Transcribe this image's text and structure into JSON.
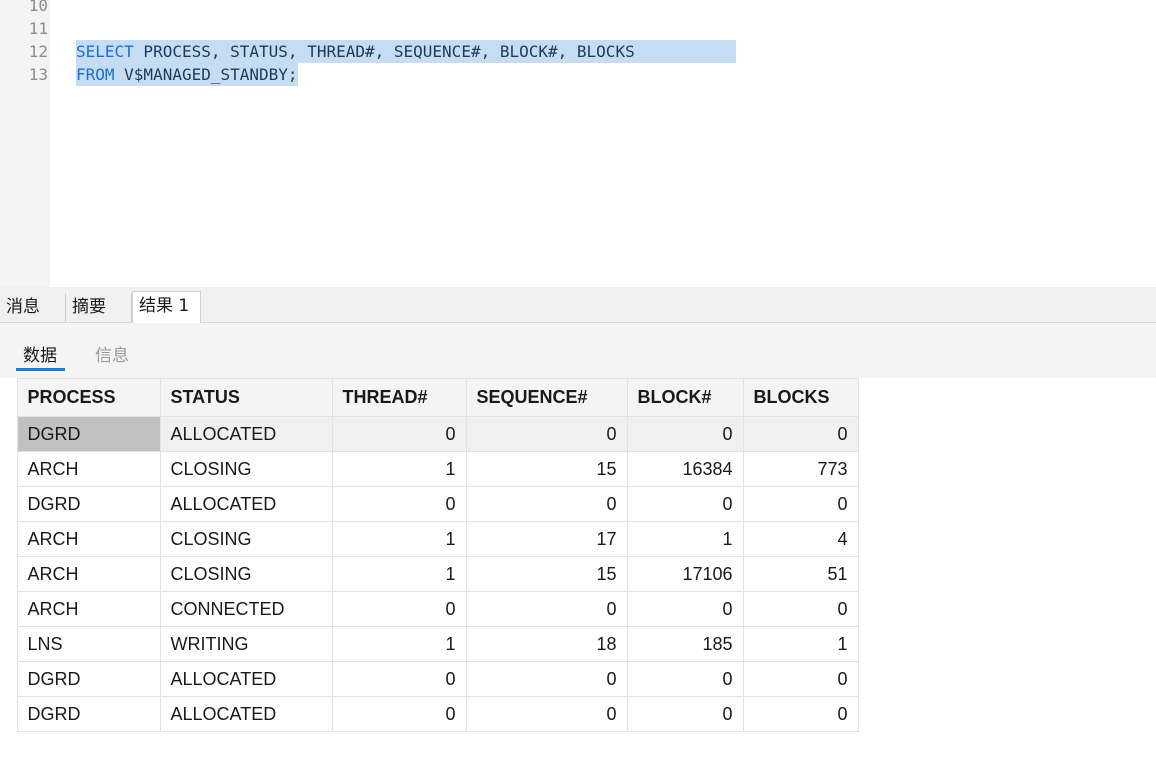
{
  "editor": {
    "lines": [
      {
        "num": "10",
        "text": ""
      },
      {
        "num": "11",
        "text": ""
      },
      {
        "num": "12",
        "kw": "SELECT",
        "rest": " PROCESS, STATUS, THREAD#, SEQUENCE#, BLOCK#, BLOCKS "
      },
      {
        "num": "13",
        "kw": "FROM",
        "rest": " V$MANAGED_STANDBY;"
      }
    ]
  },
  "result_tabs": [
    "消息",
    "摘要",
    "结果 1"
  ],
  "view_tabs": [
    "数据",
    "信息"
  ],
  "grid": {
    "columns": [
      "PROCESS",
      "STATUS",
      "THREAD#",
      "SEQUENCE#",
      "BLOCK#",
      "BLOCKS"
    ],
    "rows": [
      [
        "DGRD",
        "ALLOCATED",
        "0",
        "0",
        "0",
        "0"
      ],
      [
        "ARCH",
        "CLOSING",
        "1",
        "15",
        "16384",
        "773"
      ],
      [
        "DGRD",
        "ALLOCATED",
        "0",
        "0",
        "0",
        "0"
      ],
      [
        "ARCH",
        "CLOSING",
        "1",
        "17",
        "1",
        "4"
      ],
      [
        "ARCH",
        "CLOSING",
        "1",
        "15",
        "17106",
        "51"
      ],
      [
        "ARCH",
        "CONNECTED",
        "0",
        "0",
        "0",
        "0"
      ],
      [
        "LNS",
        "WRITING",
        "1",
        "18",
        "185",
        "1"
      ],
      [
        "DGRD",
        "ALLOCATED",
        "0",
        "0",
        "0",
        "0"
      ],
      [
        "DGRD",
        "ALLOCATED",
        "0",
        "0",
        "0",
        "0"
      ]
    ]
  },
  "colors": {
    "keyword": "#1a6fd4",
    "selection": "#c6dcf3",
    "accent_underline": "#1a7fd9"
  }
}
